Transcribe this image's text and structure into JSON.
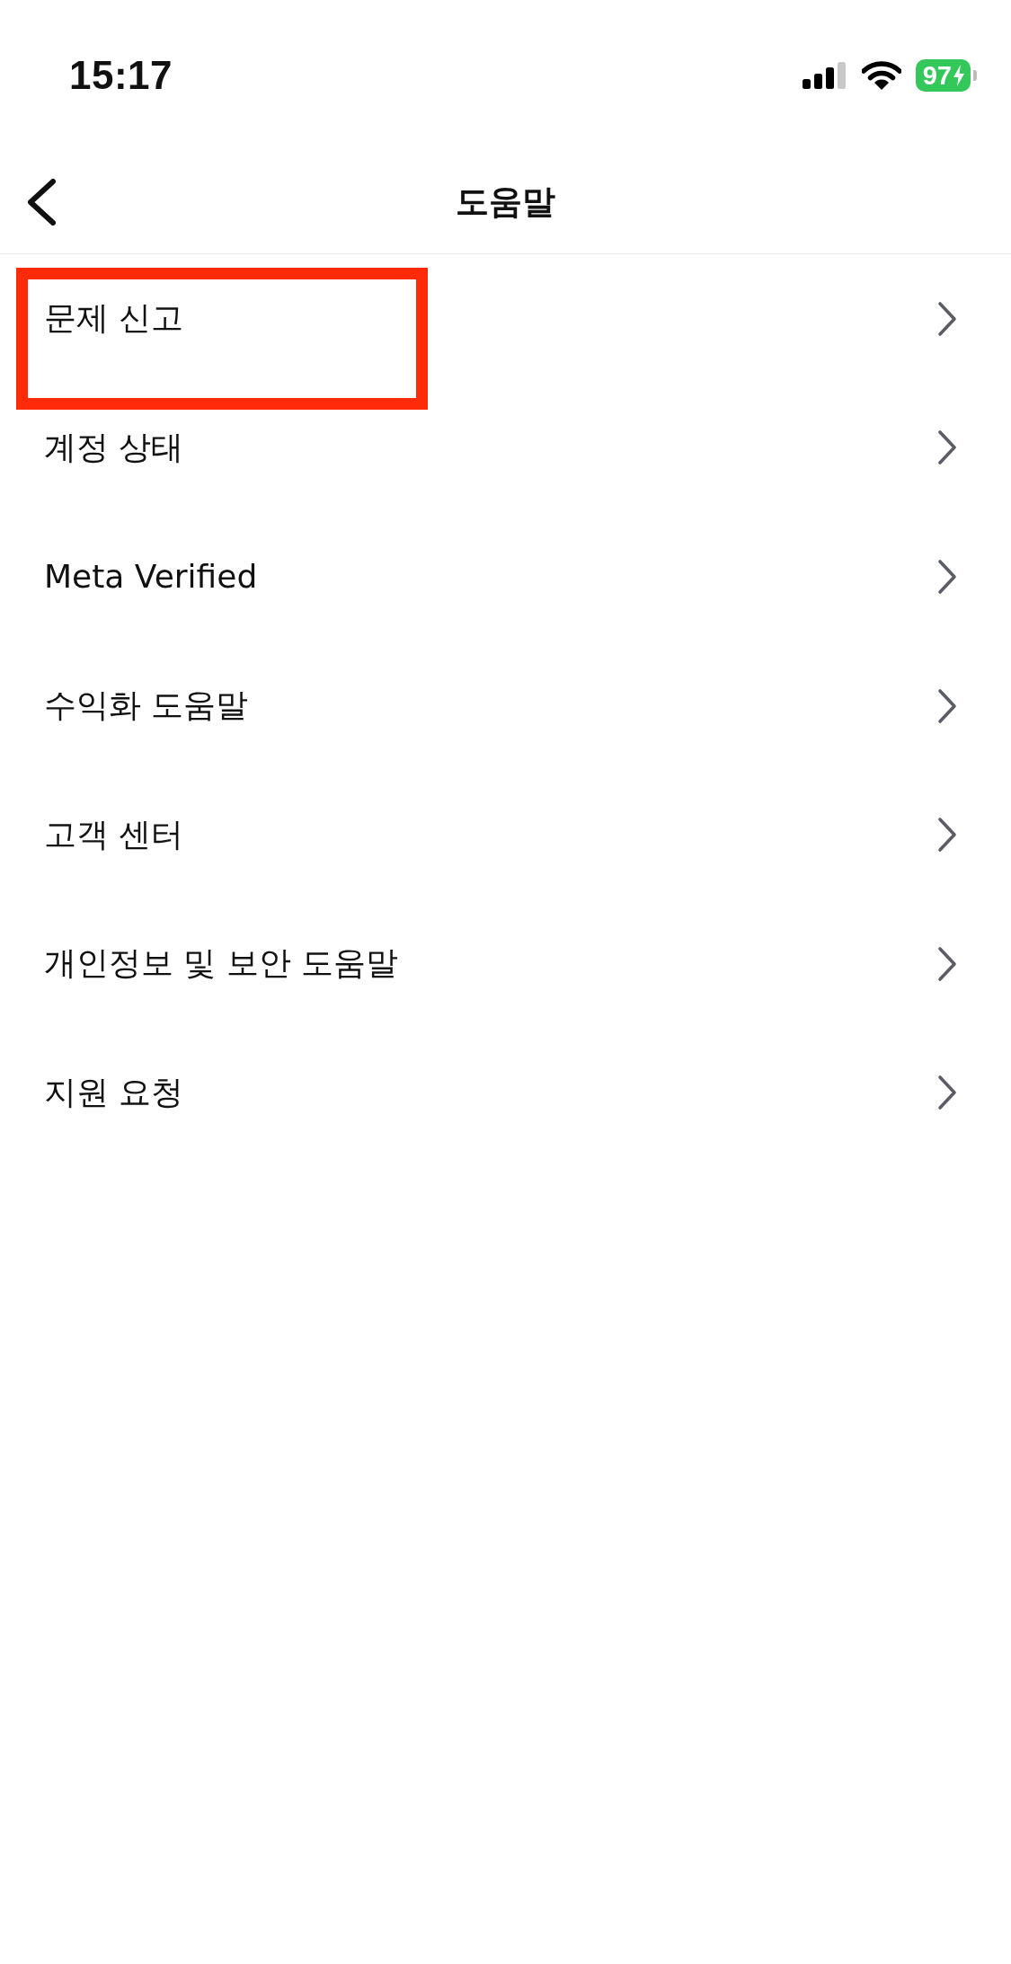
{
  "status_bar": {
    "time": "15:17",
    "battery": "97"
  },
  "nav": {
    "title": "도움말"
  },
  "items": [
    {
      "label": "문제 신고",
      "highlighted": true
    },
    {
      "label": "계정 상태",
      "highlighted": false
    },
    {
      "label": "Meta Verified",
      "highlighted": false
    },
    {
      "label": "수익화 도움말",
      "highlighted": false
    },
    {
      "label": "고객 센터",
      "highlighted": false
    },
    {
      "label": "개인정보 및 보안 도움말",
      "highlighted": false
    },
    {
      "label": "지원 요청",
      "highlighted": false
    }
  ]
}
